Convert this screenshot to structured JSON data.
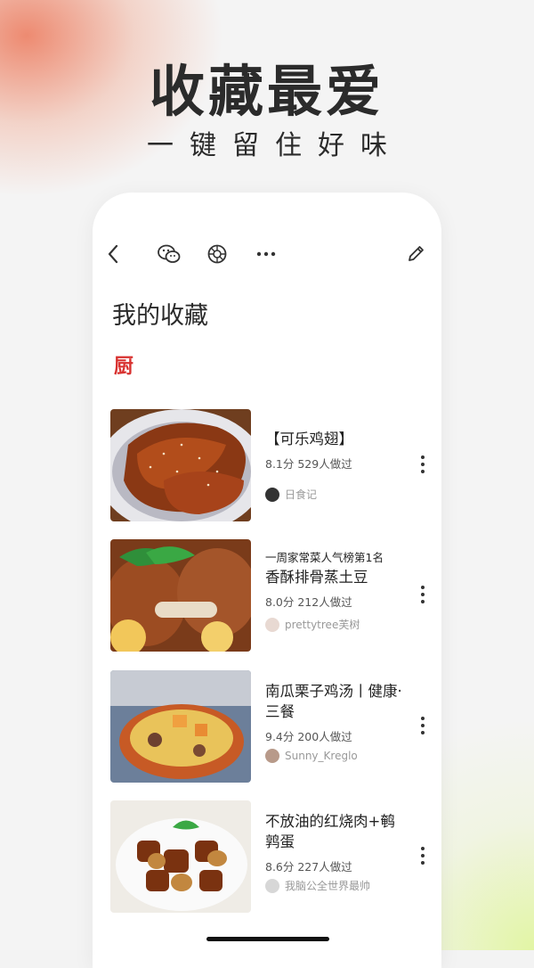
{
  "promo": {
    "headline": "收藏最爱",
    "subline": "一键留住好味"
  },
  "page": {
    "title": "我的收藏",
    "section_glyph": "厨"
  },
  "toolbar": {
    "icons": [
      "back-icon",
      "wechat-icon",
      "moments-icon",
      "more-horizontal-icon",
      "edit-icon"
    ]
  },
  "recipes": [
    {
      "kicker": "",
      "title": "【可乐鸡翅】",
      "meta": "8.1分 529人做过",
      "author": "日食记"
    },
    {
      "kicker": "一周家常菜人气榜第1名",
      "title": "香酥排骨蒸土豆",
      "meta": "8.0分 212人做过",
      "author": "prettytree芙树"
    },
    {
      "kicker": "",
      "title": "南瓜栗子鸡汤丨健康·三餐",
      "meta": "9.4分 200人做过",
      "author": "Sunny_Kreglo"
    },
    {
      "kicker": "",
      "title": "不放油的红烧肉+鹌鹑蛋",
      "meta": "8.6分 227人做过",
      "author": "我脑公全世界最帅"
    }
  ],
  "colors": {
    "brand_red": "#d8312f",
    "text": "#222222"
  }
}
